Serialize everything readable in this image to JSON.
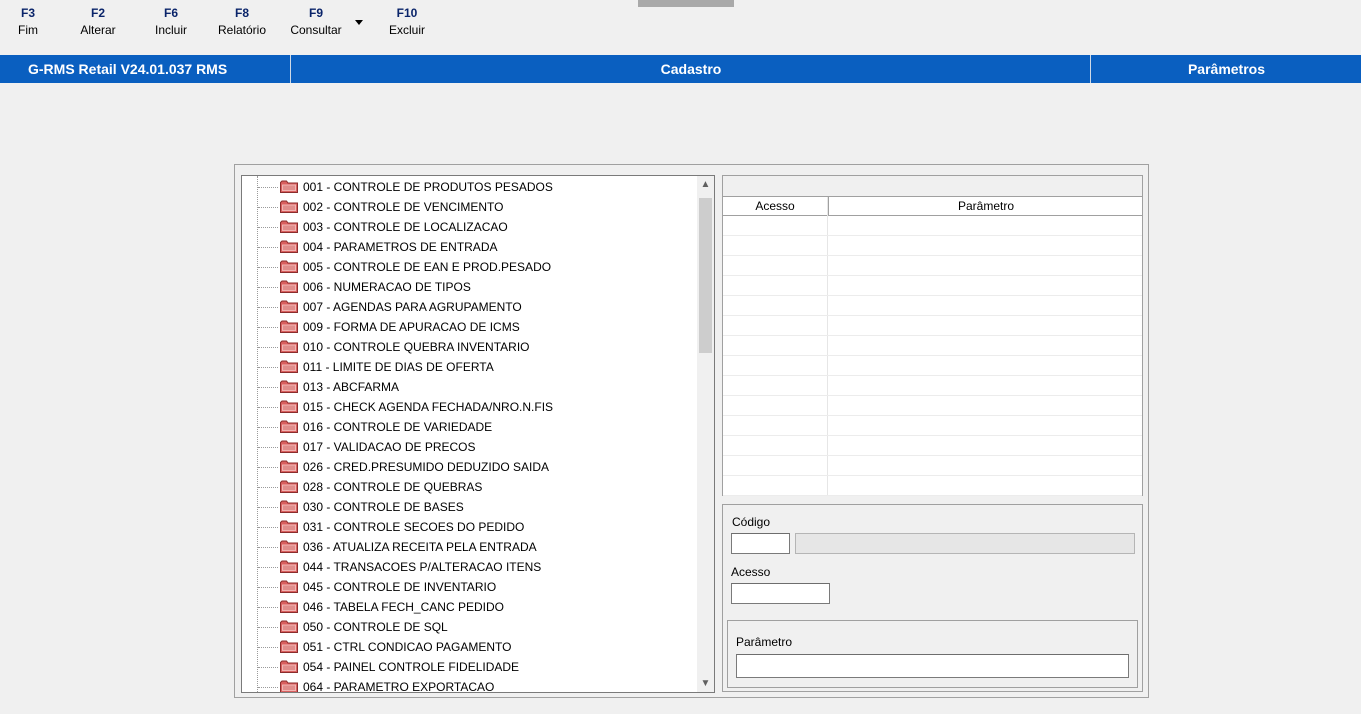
{
  "toolbar": {
    "buttons": [
      {
        "key": "F3",
        "label": "Fim"
      },
      {
        "key": "F2",
        "label": "Alterar"
      },
      {
        "key": "F6",
        "label": "Incluir"
      },
      {
        "key": "F8",
        "label": "Relatório"
      },
      {
        "key": "F9",
        "label": "Consultar"
      },
      {
        "key": "F10",
        "label": "Excluir"
      }
    ],
    "consultar_dropdown_icon": "triangle-down"
  },
  "header": {
    "app_title": "G-RMS Retail V24.01.037 RMS",
    "section": "Cadastro",
    "screen": "Parâmetros",
    "color": "#0a5fc0"
  },
  "tree": {
    "folder_icon": "folder-icon",
    "items": [
      "001 - CONTROLE DE PRODUTOS PESADOS",
      "002 - CONTROLE DE VENCIMENTO",
      "003 - CONTROLE DE LOCALIZACAO",
      "004 - PARAMETROS DE ENTRADA",
      "005 - CONTROLE DE EAN E PROD.PESADO",
      "006 - NUMERACAO DE TIPOS",
      "007 - AGENDAS PARA AGRUPAMENTO",
      "009 - FORMA DE APURACAO DE ICMS",
      "010 - CONTROLE QUEBRA INVENTARIO",
      "011 - LIMITE DE DIAS DE OFERTA",
      "013 - ABCFARMA",
      "015 - CHECK AGENDA FECHADA/NRO.N.FIS",
      "016 - CONTROLE DE VARIEDADE",
      "017 - VALIDACAO DE PRECOS",
      "026 - CRED.PRESUMIDO DEDUZIDO SAIDA",
      "028 - CONTROLE DE QUEBRAS",
      "030 - CONTROLE DE BASES",
      "031 - CONTROLE SECOES DO PEDIDO",
      "036 - ATUALIZA RECEITA PELA ENTRADA",
      "044 - TRANSACOES P/ALTERACAO ITENS",
      "045 - CONTROLE DE INVENTARIO",
      "046 - TABELA FECH_CANC PEDIDO",
      "050 - CONTROLE DE SQL",
      "051 - CTRL CONDICAO PAGAMENTO",
      "054 - PAINEL CONTROLE FIDELIDADE",
      "064 - PARAMETRO EXPORTACAO"
    ]
  },
  "grid": {
    "columns": [
      "Acesso",
      "Parâmetro"
    ]
  },
  "form": {
    "codigo_label": "Código",
    "codigo_value": "",
    "codigo_desc": "",
    "acesso_label": "Acesso",
    "acesso_value": "",
    "parametro_label": "Parâmetro",
    "parametro_value": ""
  }
}
